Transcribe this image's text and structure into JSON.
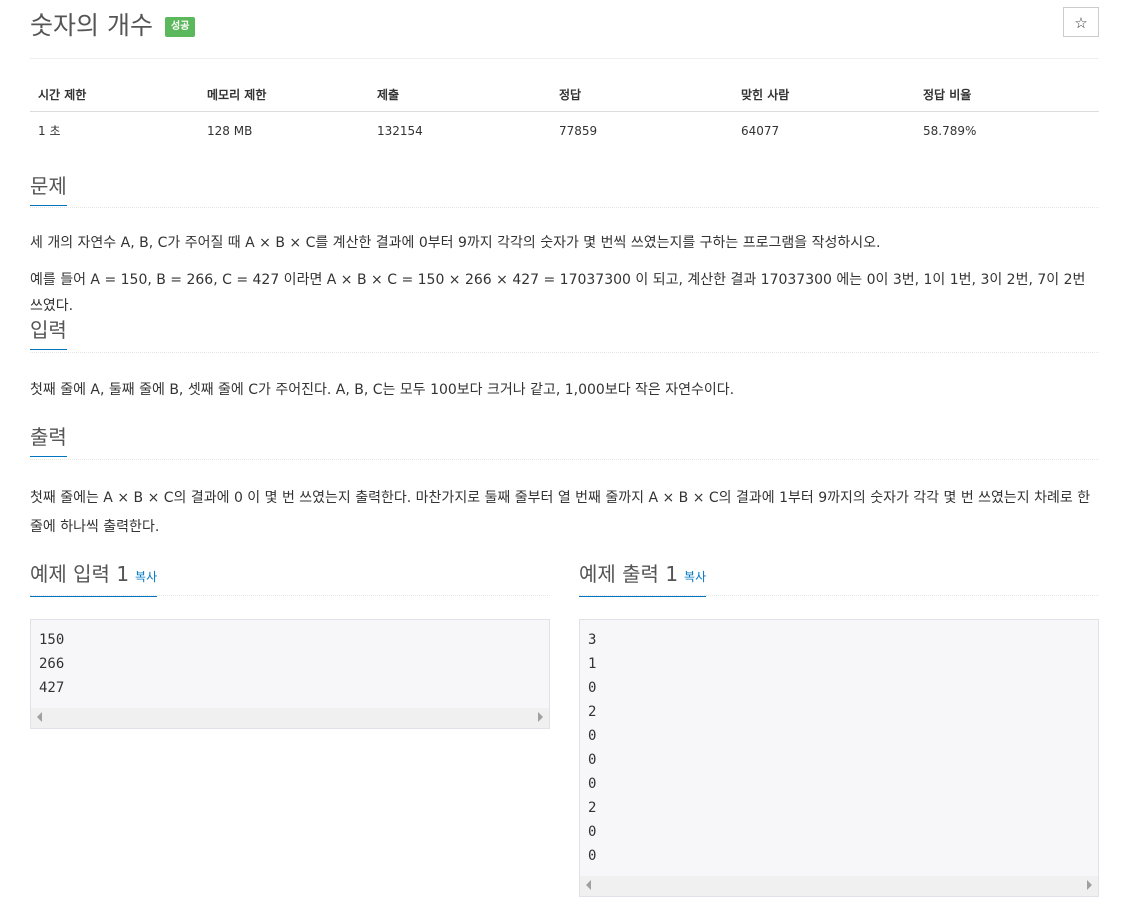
{
  "problem": {
    "title": "숫자의 개수",
    "badge": "성공",
    "star_icon": "☆"
  },
  "info_table": {
    "headers": [
      "시간 제한",
      "메모리 제한",
      "제출",
      "정답",
      "맞힌 사람",
      "정답 비율"
    ],
    "values": [
      "1 초",
      "128 MB",
      "132154",
      "77859",
      "64077",
      "58.789%"
    ]
  },
  "sections": {
    "description": {
      "heading": "문제",
      "paragraphs": [
        "세 개의 자연수 A, B, C가 주어질 때 A × B × C를 계산한 결과에 0부터 9까지 각각의 숫자가 몇 번씩 쓰였는지를 구하는 프로그램을 작성하시오.",
        "예를 들어 A = 150, B = 266, C = 427 이라면 A × B × C = 150 × 266 × 427 = 17037300 이 되고, 계산한 결과 17037300 에는 0이 3번, 1이 1번, 3이 2번, 7이 2번 쓰였다."
      ]
    },
    "input": {
      "heading": "입력",
      "paragraphs": [
        "첫째 줄에 A, 둘째 줄에 B, 셋째 줄에 C가 주어진다. A, B, C는 모두 100보다 크거나 같고, 1,000보다 작은 자연수이다."
      ]
    },
    "output": {
      "heading": "출력",
      "paragraphs": [
        "첫째 줄에는 A × B × C의 결과에 0 이 몇 번 쓰였는지 출력한다. 마찬가지로 둘째 줄부터 열 번째 줄까지 A × B × C의 결과에 1부터 9까지의 숫자가 각각 몇 번 쓰였는지 차례로 한 줄에 하나씩 출력한다."
      ]
    }
  },
  "sample_input": {
    "heading": "예제 입력 1",
    "copy_label": "복사",
    "lines": [
      "150",
      "266",
      "427"
    ]
  },
  "sample_output": {
    "heading": "예제 출력 1",
    "copy_label": "복사",
    "lines": [
      "3",
      "1",
      "0",
      "2",
      "0",
      "0",
      "0",
      "2",
      "0",
      "0"
    ]
  },
  "colors": {
    "accent": "#0076c0",
    "badge": "#5cb85c"
  },
  "icons": {
    "star": "star-icon",
    "scroll_left": "chevron-left-icon",
    "scroll_right": "chevron-right-icon"
  }
}
